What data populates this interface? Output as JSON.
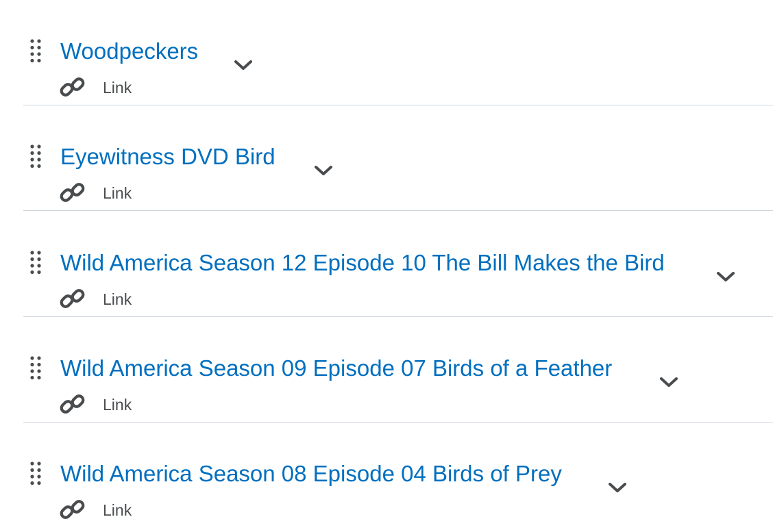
{
  "items": [
    {
      "title": "Woodpeckers",
      "type": "Link"
    },
    {
      "title": "Eyewitness DVD Bird",
      "type": "Link"
    },
    {
      "title": "Wild America Season 12 Episode 10 The Bill Makes the Bird",
      "type": "Link"
    },
    {
      "title": "Wild America Season 09 Episode 07 Birds of a Feather",
      "type": "Link"
    },
    {
      "title": "Wild America Season 08 Episode 04 Birds of Prey",
      "type": "Link"
    }
  ],
  "icons": {
    "drag": "drag-handle-icon",
    "menu": "chevron-down-icon",
    "type": "link-icon"
  },
  "colors": {
    "title": "#006fbf",
    "label": "#494c4e",
    "divider": "#cdd5dc",
    "icon": "#494c4e"
  }
}
